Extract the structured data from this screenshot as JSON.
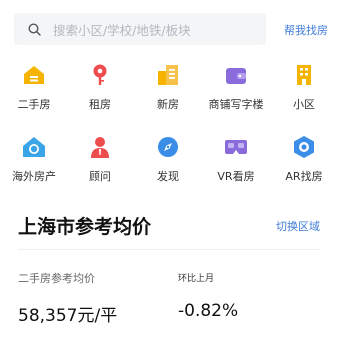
{
  "search": {
    "placeholder": "搜索小区/学校/地铁/板块",
    "help_label": "帮我找房"
  },
  "nav_row1": [
    {
      "label": "二手房",
      "icon": "second-hand-house-icon",
      "color": "#f6b400"
    },
    {
      "label": "租房",
      "icon": "rent-pin-icon",
      "color": "#ee4d4d"
    },
    {
      "label": "新房",
      "icon": "new-house-building-icon",
      "color": "#f6b400"
    },
    {
      "label": "商铺写字楼",
      "icon": "shop-office-wallet-icon",
      "color": "#8a6bdc"
    },
    {
      "label": "小区",
      "icon": "community-building-icon",
      "color": "#f6b400"
    }
  ],
  "nav_row2": [
    {
      "label": "海外房产",
      "icon": "overseas-house-icon",
      "color": "#3aa4e8"
    },
    {
      "label": "顾问",
      "icon": "advisor-person-icon",
      "color": "#ee4d4d"
    },
    {
      "label": "发现",
      "icon": "discover-compass-icon",
      "color": "#3a8ee8"
    },
    {
      "label": "VR看房",
      "icon": "vr-goggles-icon",
      "color": "#8a6bdc"
    },
    {
      "label": "AR找房",
      "icon": "ar-hexagon-icon",
      "color": "#3a8ee8"
    }
  ],
  "section": {
    "title": "上海市参考均价",
    "switch_label": "切换区域"
  },
  "stats": {
    "label1": "二手房参考均价",
    "label2": "环比上月",
    "value1": "58,357元/平",
    "value2": "-0.82%"
  }
}
